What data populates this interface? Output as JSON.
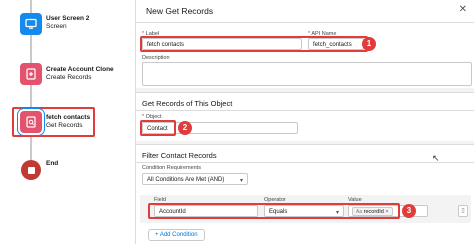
{
  "canvas": {
    "nodes": [
      {
        "title": "User Screen 2",
        "subtitle": "Screen"
      },
      {
        "title": "Create Account Clone",
        "subtitle": "Create Records"
      },
      {
        "title": "fetch contacts",
        "subtitle": "Get Records"
      },
      {
        "title": "End",
        "subtitle": ""
      }
    ]
  },
  "panel": {
    "title": "New Get Records",
    "label_field": {
      "label": "Label",
      "value": "fetch contacts"
    },
    "api_field": {
      "label": "API Name",
      "value": "fetch_contacts"
    },
    "description": {
      "label": "Description",
      "value": ""
    },
    "object_section": {
      "title": "Get Records of This Object",
      "object_label": "Object",
      "object_value": "Contact"
    },
    "filter_section": {
      "title": "Filter Contact Records",
      "condition_label": "Condition Requirements",
      "condition_value": "All Conditions Are Met (AND)",
      "field_header": "Field",
      "operator_header": "Operator",
      "value_header": "Value",
      "row": {
        "field": "AccountId",
        "operator": "Equals",
        "value": "recordId",
        "value_prefix": "Aa"
      },
      "add_condition": "+ Add Condition"
    },
    "badges": [
      "1",
      "2",
      "3"
    ]
  },
  "colors": {
    "accent_red": "#e03c3c",
    "screen_blue": "#1589ee",
    "create_pink": "#e3536e",
    "get_pink": "#e3536e",
    "end_red": "#c23934"
  },
  "icons": [
    "screen-icon",
    "create-records-icon",
    "get-records-icon",
    "end-icon",
    "close-icon",
    "dropdown-icon",
    "trash-icon",
    "cursor-icon"
  ]
}
